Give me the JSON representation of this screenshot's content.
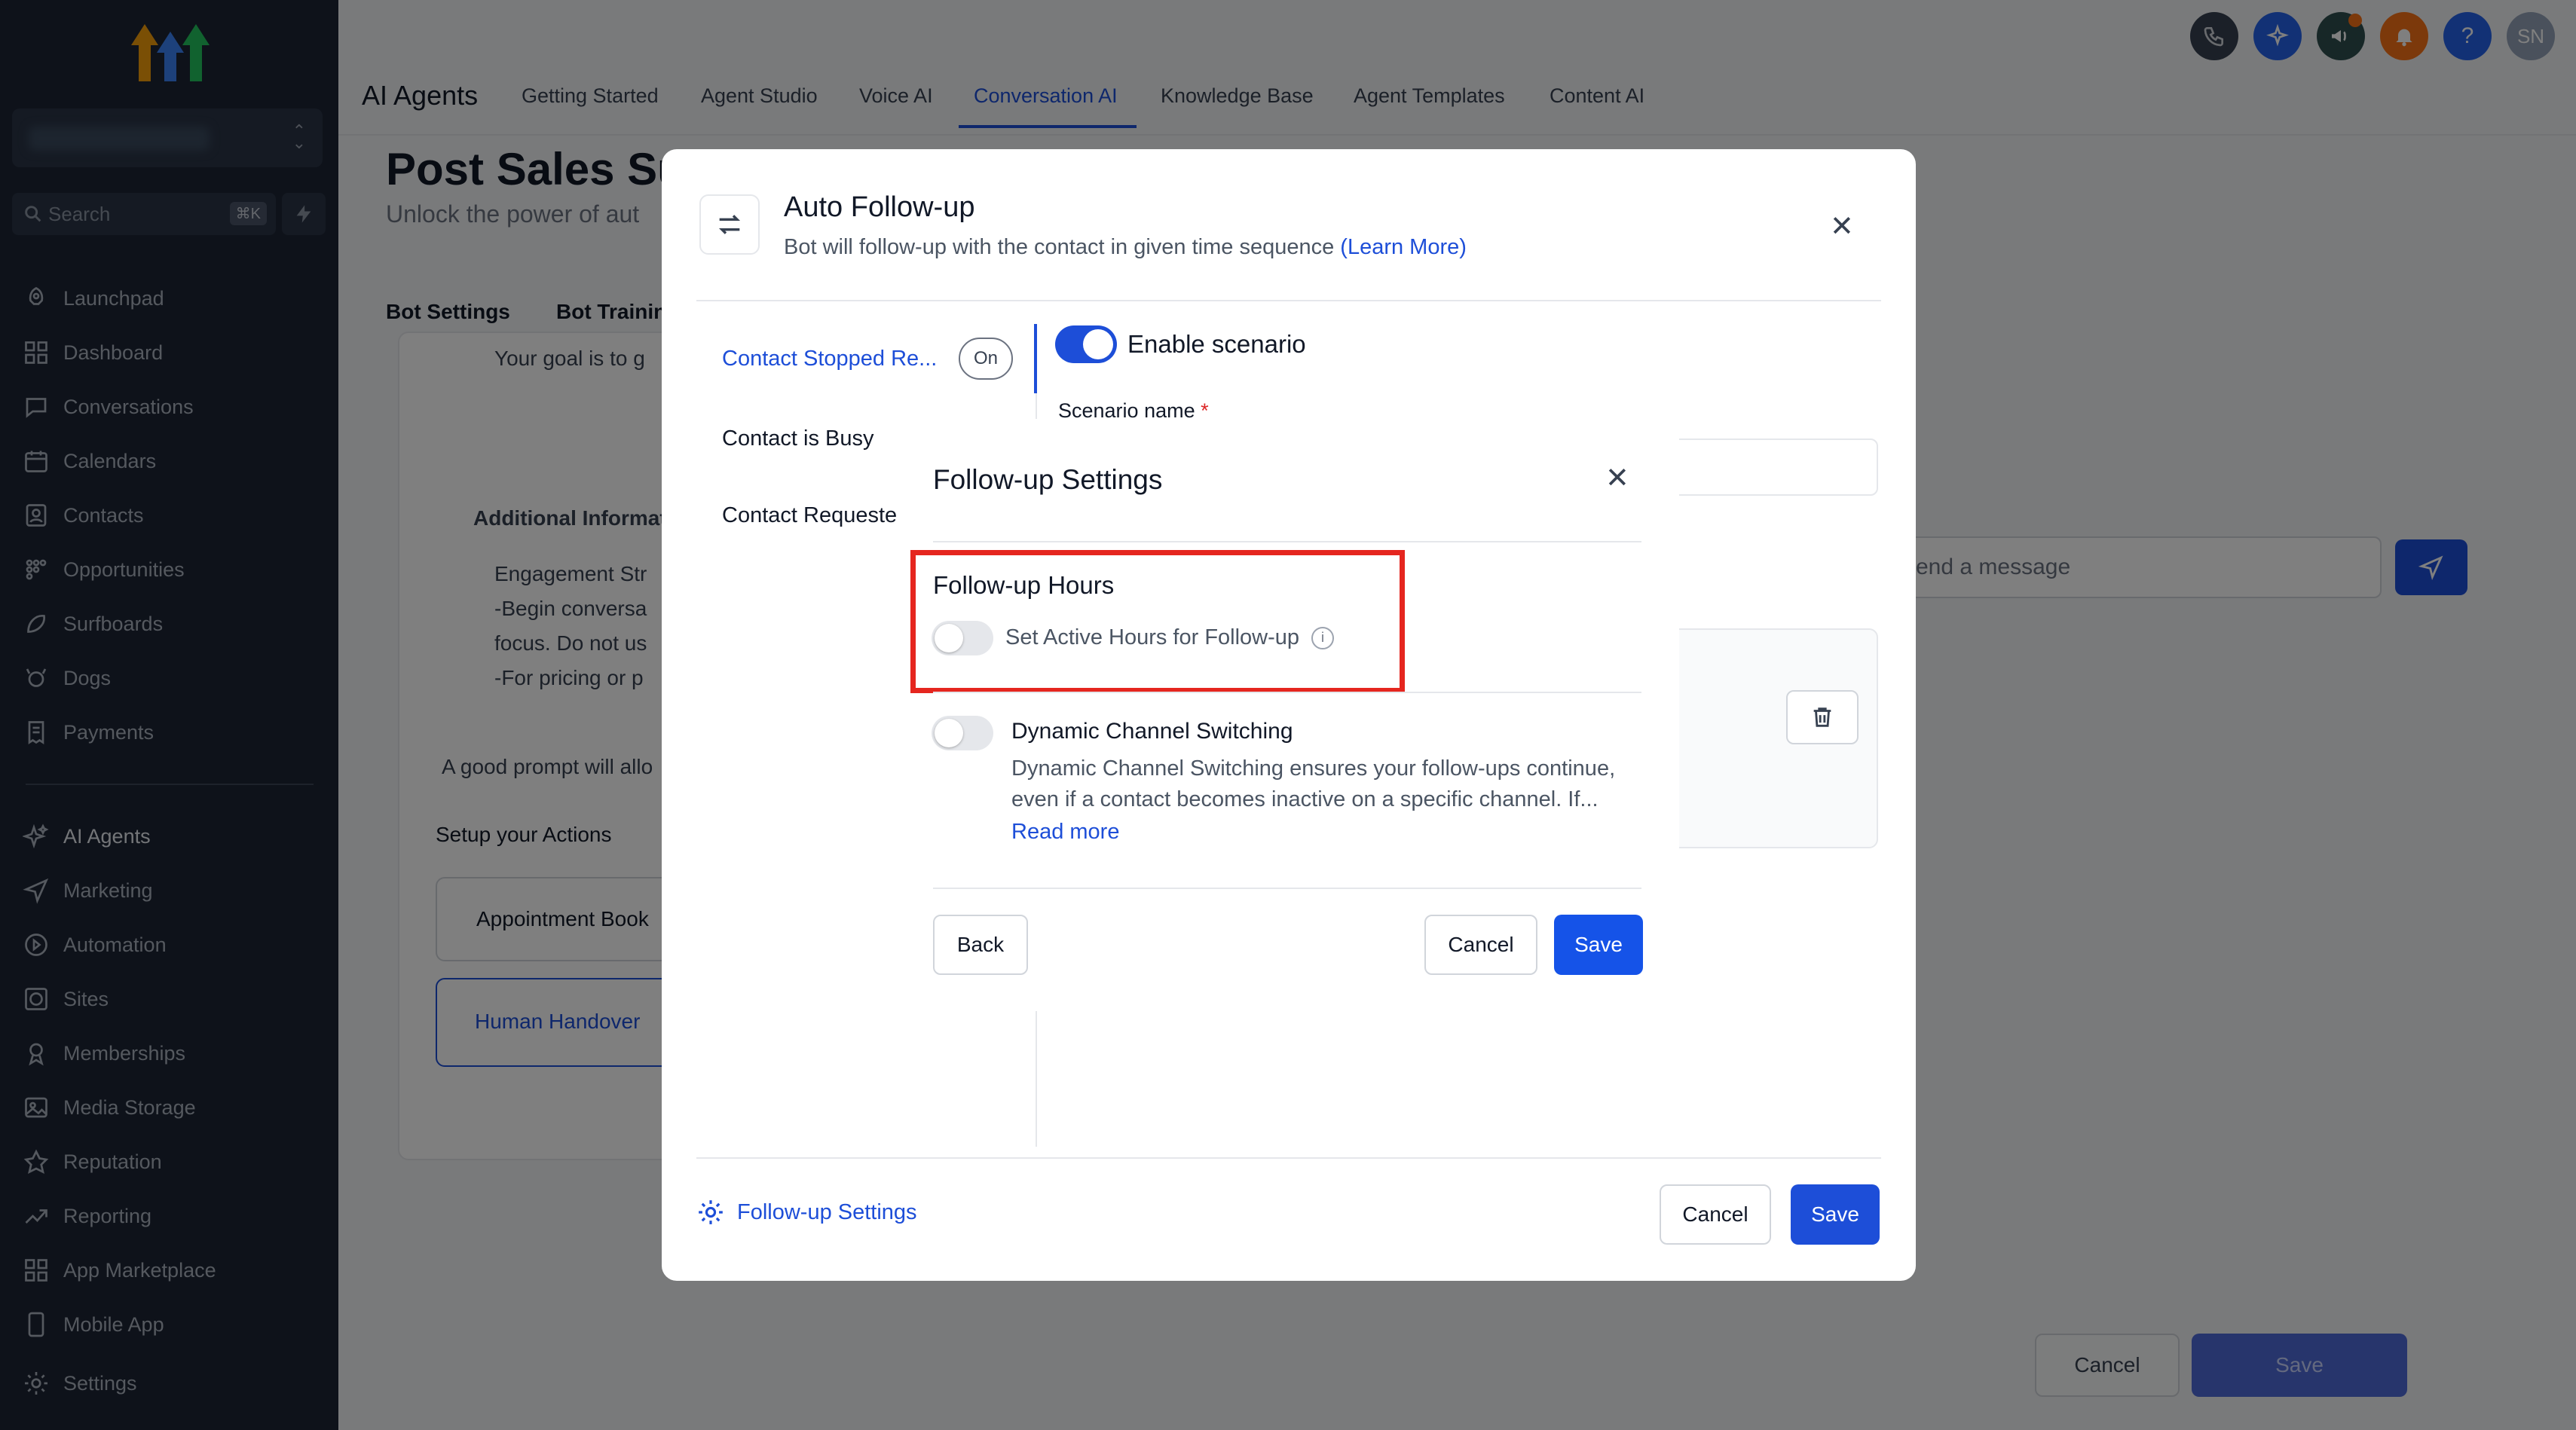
{
  "sidebar": {
    "search_label": "Search",
    "search_shortcut": "⌘K",
    "items": [
      {
        "label": "Launchpad",
        "icon": "rocket-icon"
      },
      {
        "label": "Dashboard",
        "icon": "grid-icon"
      },
      {
        "label": "Conversations",
        "icon": "chat-icon"
      },
      {
        "label": "Calendars",
        "icon": "calendar-icon"
      },
      {
        "label": "Contacts",
        "icon": "contacts-icon"
      },
      {
        "label": "Opportunities",
        "icon": "funnel-icon"
      },
      {
        "label": "Surfboards",
        "icon": "surfboard-icon"
      },
      {
        "label": "Dogs",
        "icon": "dog-icon"
      },
      {
        "label": "Payments",
        "icon": "receipt-icon"
      }
    ],
    "items2": [
      {
        "label": "AI Agents",
        "icon": "sparkle-icon"
      },
      {
        "label": "Marketing",
        "icon": "send-icon"
      },
      {
        "label": "Automation",
        "icon": "automation-icon"
      },
      {
        "label": "Sites",
        "icon": "globe-icon"
      },
      {
        "label": "Memberships",
        "icon": "membership-icon"
      },
      {
        "label": "Media Storage",
        "icon": "image-icon"
      },
      {
        "label": "Reputation",
        "icon": "star-icon"
      },
      {
        "label": "Reporting",
        "icon": "chart-icon"
      },
      {
        "label": "App Marketplace",
        "icon": "apps-icon"
      },
      {
        "label": "Mobile App",
        "icon": "phone-icon"
      }
    ],
    "settings_label": "Settings"
  },
  "header": {
    "title": "AI Agents",
    "tabs": [
      "Getting Started",
      "Agent Studio",
      "Voice AI",
      "Conversation AI",
      "Knowledge Base",
      "Agent Templates",
      "Content AI"
    ],
    "active_tab": "Conversation AI",
    "avatar_initials": "SN",
    "help": "?"
  },
  "background": {
    "heading": "Post Sales Su",
    "subheading": "Unlock the power of aut",
    "bot_tabs": [
      "Bot Settings",
      "Bot Trainin"
    ],
    "goal_text": "Your goal is to g",
    "additional": "Additional Informati",
    "engagement_lines": [
      "Engagement Str",
      "-Begin conversa",
      "focus. Do not us",
      "-For pricing or p"
    ],
    "prompt_hint": "A good prompt will allo",
    "actions_title": "Setup your Actions",
    "action1": "Appointment Book",
    "action2": "Human Handover",
    "message_placeholder": "end a message",
    "cancel": "Cancel",
    "save": "Save"
  },
  "auto_followup": {
    "title": "Auto Follow-up",
    "description": "Bot will follow-up with the contact in given time sequence",
    "learn_more": "(Learn More)",
    "scenarios": [
      "Contact Stopped Re...",
      "Contact is Busy",
      "Contact Requeste"
    ],
    "on_label": "On",
    "enable_label": "Enable scenario",
    "scenario_name_label": "Scenario name",
    "required": "*",
    "followup_settings_link": "Follow-up Settings",
    "cancel": "Cancel",
    "save": "Save"
  },
  "followup_settings": {
    "title": "Follow-up Settings",
    "hours_title": "Follow-up Hours",
    "active_hours_label": "Set Active Hours for Follow-up",
    "active_hours_enabled": false,
    "dcs_title": "Dynamic Channel Switching",
    "dcs_enabled": false,
    "dcs_desc_1": "Dynamic Channel Switching ensures your follow-ups continue,",
    "dcs_desc_2": "even if a contact becomes inactive on a specific channel. If...",
    "read_more": "Read more",
    "back": "Back",
    "cancel": "Cancel",
    "save": "Save"
  },
  "colors": {
    "accent": "#1d4ed8",
    "highlight": "#e5261f",
    "sidebar": "#1c2434"
  }
}
